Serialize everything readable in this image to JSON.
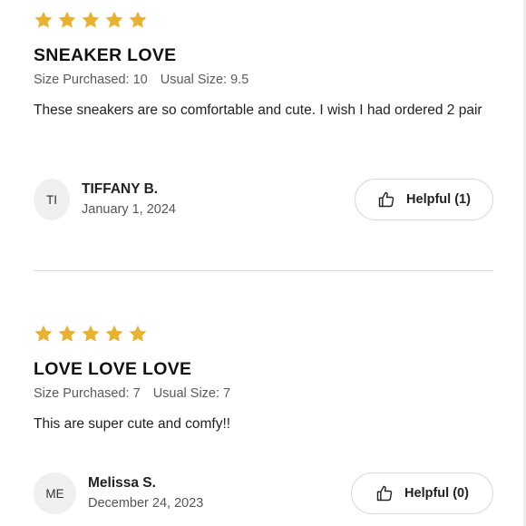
{
  "colors": {
    "star": "#E8B22E",
    "divider": "#DCDCDC",
    "avatar_bg": "#F0F0F0"
  },
  "reviews": [
    {
      "rating": 5,
      "title": "SNEAKER LOVE",
      "size_purchased": "Size Purchased: 10",
      "usual_size": "Usual Size: 9.5",
      "body": "These sneakers are so comfortable and cute. I wish I had ordered 2 pair",
      "avatar_initials": "TI",
      "author": "TIFFANY B.",
      "date": "January 1, 2024",
      "helpful_label": "Helpful (1)",
      "helpful_icon": "thumbs-up-icon"
    },
    {
      "rating": 5,
      "title": "LOVE LOVE LOVE",
      "size_purchased": "Size Purchased: 7",
      "usual_size": "Usual Size: 7",
      "body": "This are super cute and comfy!!",
      "avatar_initials": "ME",
      "author": "Melissa S.",
      "date": "December 24, 2023",
      "helpful_label": "Helpful (0)",
      "helpful_icon": "thumbs-up-icon"
    }
  ]
}
